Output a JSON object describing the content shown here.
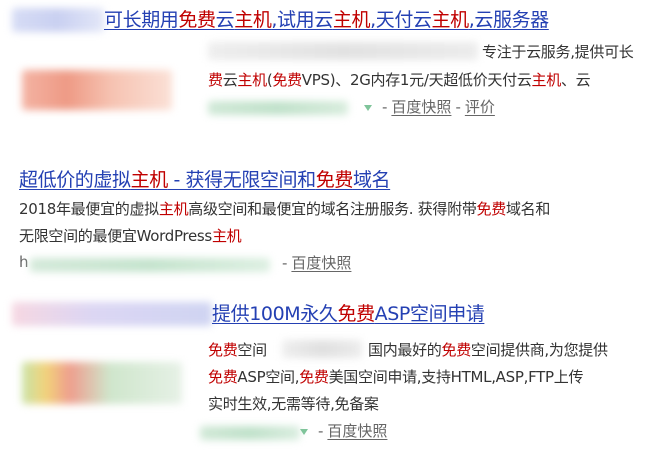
{
  "results": [
    {
      "title": [
        {
          "t": "可长期用",
          "hl": false
        },
        {
          "t": "免费",
          "hl": true
        },
        {
          "t": "云",
          "hl": false
        },
        {
          "t": "主机",
          "hl": true
        },
        {
          "t": ",试用云",
          "hl": false
        },
        {
          "t": "主机",
          "hl": true
        },
        {
          "t": ",天付云",
          "hl": false
        },
        {
          "t": "主机",
          "hl": true
        },
        {
          "t": ",云服务器",
          "hl": false
        }
      ],
      "lines": [
        [
          {
            "t": "专注于云服务,提供可长",
            "hl": false
          }
        ],
        [
          {
            "t": "费",
            "hl": true
          },
          {
            "t": "云",
            "hl": false
          },
          {
            "t": "主机",
            "hl": true
          },
          {
            "t": "(",
            "hl": false
          },
          {
            "t": "免费",
            "hl": true
          },
          {
            "t": "VPS)、2G内存1元/天超低价天付云",
            "hl": false
          },
          {
            "t": "主机",
            "hl": true
          },
          {
            "t": "、云",
            "hl": false
          }
        ]
      ],
      "links": [
        "百度快照",
        "评价"
      ]
    },
    {
      "title": [
        {
          "t": "超低价的虚拟",
          "hl": false
        },
        {
          "t": "主机",
          "hl": true
        },
        {
          "t": " - 获得无限空间和",
          "hl": false
        },
        {
          "t": "免费",
          "hl": true
        },
        {
          "t": "域名",
          "hl": false
        }
      ],
      "lines": [
        [
          {
            "t": "2018年最便宜的虚拟",
            "hl": false
          },
          {
            "t": "主机",
            "hl": true
          },
          {
            "t": "高级空间和最便宜的域名注册服务. 获得附带",
            "hl": false
          },
          {
            "t": "免费",
            "hl": true
          },
          {
            "t": "域名和",
            "hl": false
          }
        ],
        [
          {
            "t": "无限空间的最便宜WordPress",
            "hl": false
          },
          {
            "t": "主机",
            "hl": true
          }
        ]
      ],
      "url_prefix": "h",
      "links": [
        "百度快照"
      ]
    },
    {
      "title": [
        {
          "t": "提供100M永久",
          "hl": false
        },
        {
          "t": "免费",
          "hl": true
        },
        {
          "t": "ASP空间申请",
          "hl": false
        }
      ],
      "lines": [
        [
          {
            "t": "免费",
            "hl": true
          },
          {
            "t": "空间",
            "hl": false
          }
        ],
        [
          {
            "t": "国内最好的",
            "hl": false
          },
          {
            "t": "免费",
            "hl": true
          },
          {
            "t": "空间提供商,为您提供",
            "hl": false
          }
        ],
        [
          {
            "t": "免费",
            "hl": true
          },
          {
            "t": "ASP空间,",
            "hl": false
          },
          {
            "t": "免费",
            "hl": true
          },
          {
            "t": "美国空间申请,支持HTML,ASP,FTP上传",
            "hl": false
          }
        ],
        [
          {
            "t": "实时生效,无需等待,免备案",
            "hl": false
          }
        ]
      ],
      "links": [
        "百度快照"
      ]
    }
  ],
  "colors": {
    "title": "#2440b3",
    "highlight": "#c00000",
    "text": "#333333",
    "link": "#666666",
    "url_green": "#7fc49a"
  }
}
